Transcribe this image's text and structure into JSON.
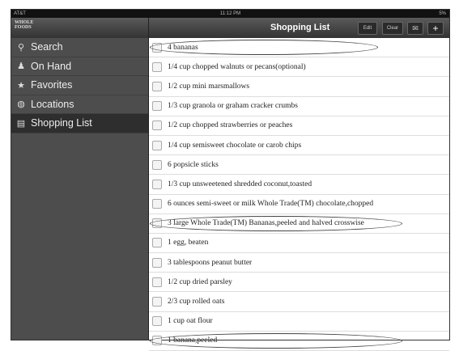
{
  "status": {
    "carrier": "AT&T",
    "time": "11:12 PM",
    "battery": "5%"
  },
  "logo": "WHOLE FOODS",
  "sidebar": {
    "items": [
      {
        "label": "Search",
        "icon": "search-icon"
      },
      {
        "label": "On Hand",
        "icon": "on-hand-icon"
      },
      {
        "label": "Favorites",
        "icon": "star-icon"
      },
      {
        "label": "Locations",
        "icon": "globe-icon"
      },
      {
        "label": "Shopping List",
        "icon": "list-icon",
        "selected": true
      }
    ]
  },
  "header": {
    "title": "Shopping List",
    "edit": "Edit",
    "clear": "Clear"
  },
  "items": [
    "4 bananas",
    "1/4 cup chopped walnuts or pecans(optional)",
    "1/2 cup mini marsmallows",
    "1/3 cup granola or graham cracker crumbs",
    "1/2 cup chopped strawberries or peaches",
    "1/4 cup semisweet chocolate or carob chips",
    "6 popsicle sticks",
    "1/3 cup unsweetened shredded coconut,toasted",
    "6 ounces semi-sweet or milk Whole Trade(TM) chocolate,chopped",
    "3 large Whole Trade(TM) Bananas,peeled and halved crosswise",
    "1 egg, beaten",
    "3 tablespoons peanut butter",
    "1/2 cup dried parsley",
    "2/3 cup rolled oats",
    "1 cup oat flour",
    "1 banana,peeled"
  ]
}
